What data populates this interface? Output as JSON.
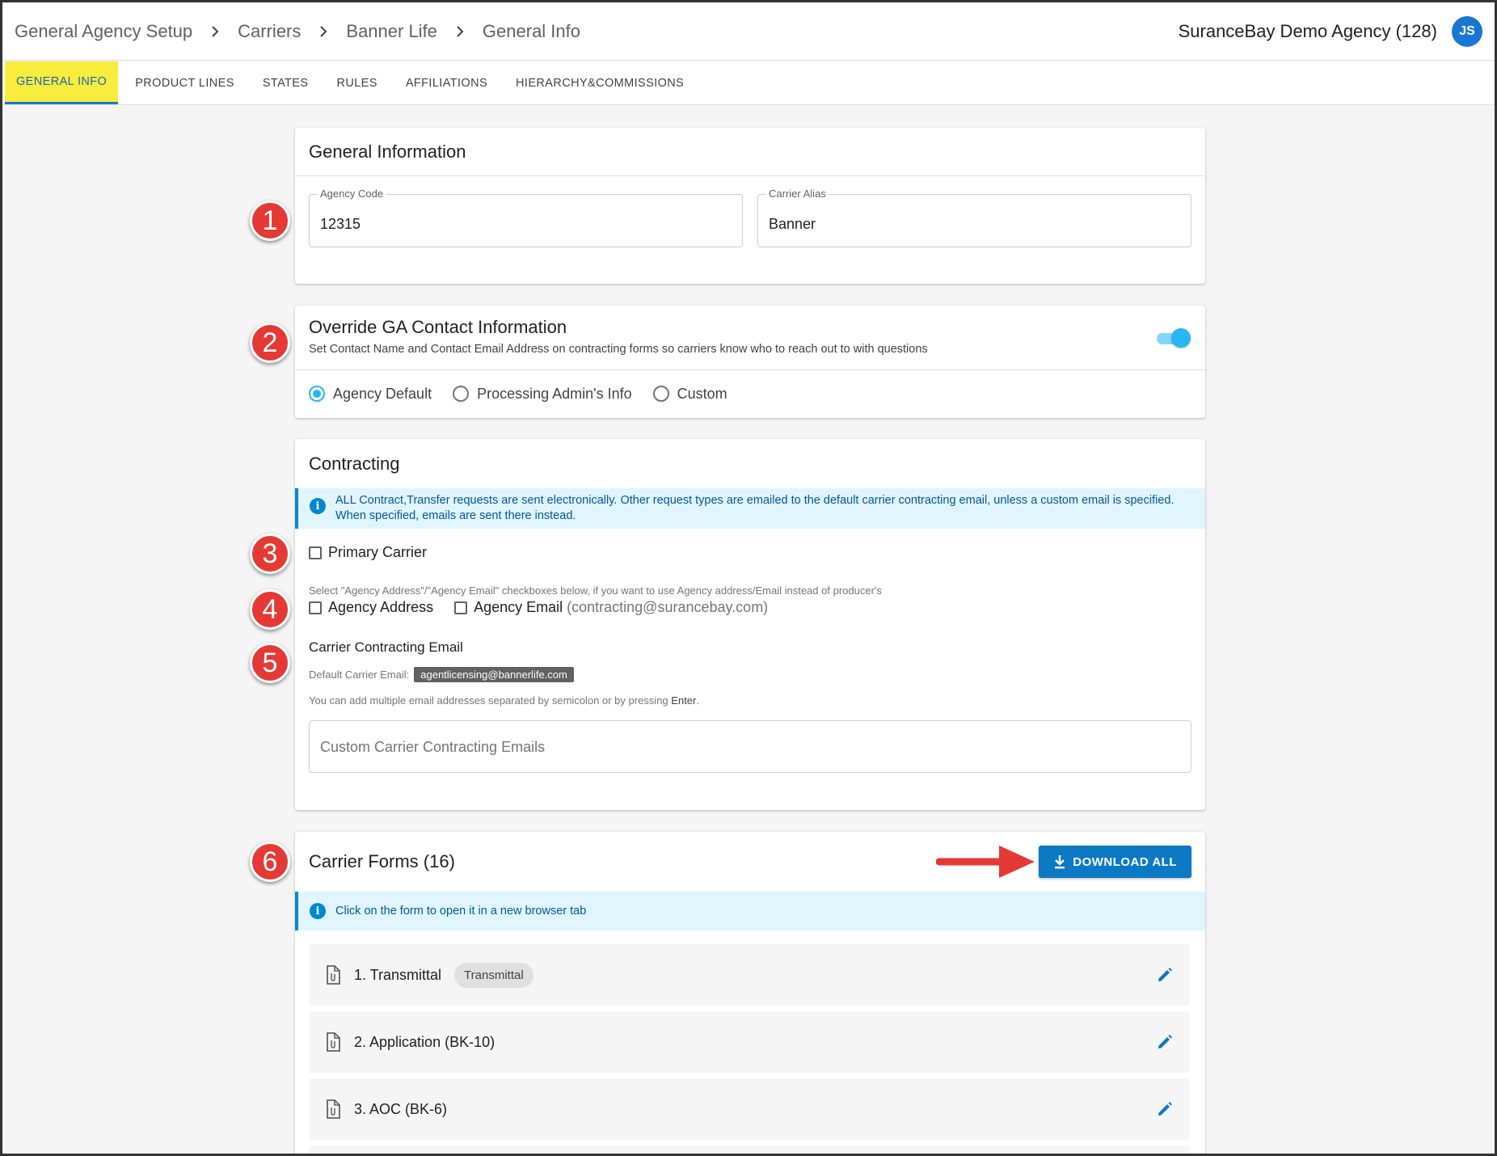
{
  "breadcrumb": [
    "General Agency Setup",
    "Carriers",
    "Banner Life",
    "General Info"
  ],
  "header": {
    "agency_name": "SuranceBay Demo Agency (128)",
    "avatar_initials": "JS"
  },
  "tabs": [
    {
      "label": "GENERAL INFO",
      "active": true
    },
    {
      "label": "PRODUCT LINES"
    },
    {
      "label": "STATES"
    },
    {
      "label": "RULES"
    },
    {
      "label": "AFFILIATIONS"
    },
    {
      "label": "HIERARCHY&COMMISSIONS"
    }
  ],
  "badges": [
    "1",
    "2",
    "3",
    "4",
    "5",
    "6"
  ],
  "general_info": {
    "title": "General Information",
    "agency_code_label": "Agency Code",
    "agency_code_value": "12315",
    "carrier_alias_label": "Carrier Alias",
    "carrier_alias_value": "Banner"
  },
  "override": {
    "title": "Override GA Contact Information",
    "subtitle": "Set Contact Name and Contact Email Address on contracting forms so carriers know who to reach out to with questions",
    "toggle_on": true,
    "options": [
      "Agency Default",
      "Processing Admin's Info",
      "Custom"
    ],
    "selected": "Agency Default"
  },
  "contracting": {
    "title": "Contracting",
    "info_text": "ALL Contract,Transfer requests are sent electronically. Other request types are emailed to the default carrier contracting email, unless a custom email is specified. When specified, emails are sent there instead.",
    "primary_carrier_label": "Primary Carrier",
    "address_hint": "Select \"Agency Address\"/\"Agency Email\" checkboxes below, if you want to use Agency address/Email instead of producer's",
    "agency_address_label": "Agency Address",
    "agency_email_label": "Agency Email",
    "agency_email_value": "(contracting@surancebay.com)",
    "carrier_email_title": "Carrier Contracting Email",
    "default_email_label": "Default Carrier Email:",
    "default_email_value": "agentlicensing@bannerlife.com",
    "multi_hint_prefix": "You can add multiple email addresses separated by semicolon or by pressing",
    "multi_hint_key": "Enter",
    "custom_emails_placeholder": "Custom Carrier Contracting Emails"
  },
  "carrier_forms": {
    "title": "Carrier Forms (16)",
    "download_label": "DOWNLOAD ALL",
    "info_text": "Click on the form to open it in a new browser tab",
    "forms": [
      {
        "name": "1. Transmittal",
        "tag": "Transmittal"
      },
      {
        "name": "2. Application (BK-10)",
        "tag": ""
      },
      {
        "name": "3. AOC (BK-6)",
        "tag": ""
      }
    ]
  },
  "colors": {
    "accent": "#1976d2",
    "active_tab_bg": "#f8ec3c",
    "badge": "#e53935",
    "info_bg": "#e1f5fe",
    "toggle": "#29b6f6"
  }
}
